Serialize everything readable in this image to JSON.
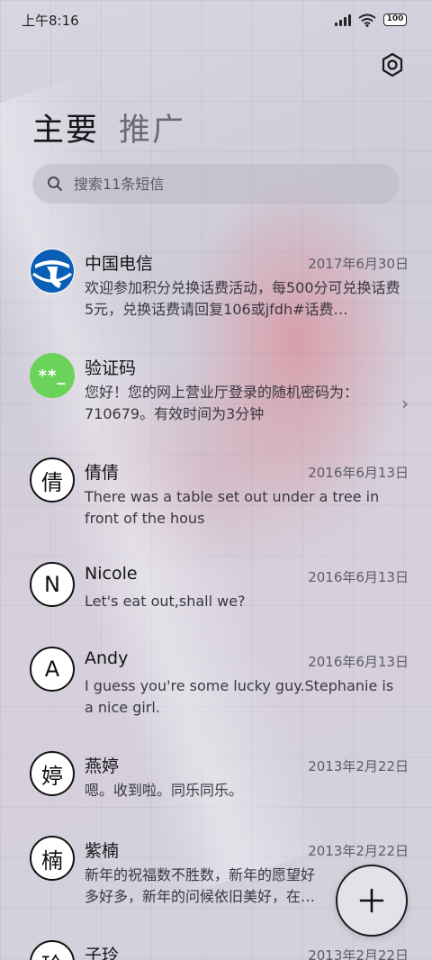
{
  "status_bar": {
    "time": "上午8:16",
    "battery": "100"
  },
  "header": {
    "tabs": [
      {
        "label": "主要",
        "active": true
      },
      {
        "label": "推广",
        "active": false
      }
    ],
    "settings_icon": "gear-icon"
  },
  "search": {
    "placeholder": "搜索11条短信",
    "icon": "search-icon"
  },
  "messages": [
    {
      "sender": "中国电信",
      "date": "2017年6月30日",
      "preview": "欢迎参加积分兑换话费活动，每500分可兑换话费5元，兑换话费请回复106或jfdh#话费…",
      "avatar": "china-telecom-logo"
    },
    {
      "sender": "验证码",
      "date": "",
      "preview": "您好！您的网上营业厅登录的随机密码为：710679。有效时间为3分钟",
      "avatar_text": "**_"
    },
    {
      "sender": "倩倩",
      "date": "2016年6月13日",
      "preview": "There was a table set out under a tree in front of the hous",
      "avatar_text": "倩"
    },
    {
      "sender": "Nicole",
      "date": "2016年6月13日",
      "preview": "Let's eat out,shall we?",
      "avatar_text": "N"
    },
    {
      "sender": "Andy",
      "date": "2016年6月13日",
      "preview": "I guess you're some lucky guy.Stephanie is a nice girl.",
      "avatar_text": "A"
    },
    {
      "sender": "燕婷",
      "date": "2013年2月22日",
      "preview": "嗯。收到啦。同乐同乐。",
      "avatar_text": "婷"
    },
    {
      "sender": "紫楠",
      "date": "2013年2月22日",
      "preview": "新年的祝福数不胜数，新年的愿望好多好多，新年的问候依旧美好，在这个温馨的",
      "avatar_text": "楠"
    },
    {
      "sender": "子玲",
      "date": "2013年2月22日",
      "preview": "",
      "avatar_text": "玲"
    }
  ],
  "fab": {
    "icon": "plus-icon"
  }
}
